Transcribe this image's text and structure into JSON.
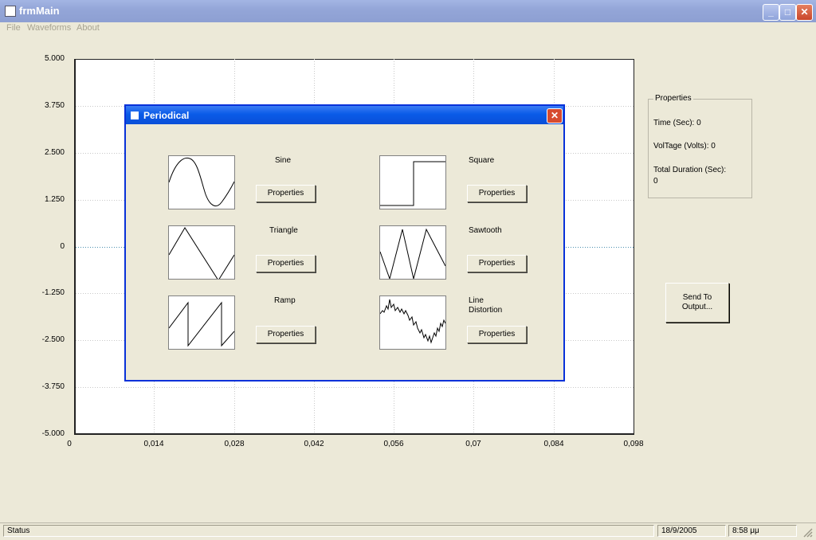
{
  "window": {
    "title": "frmMain"
  },
  "menu": [
    "File",
    "Waveforms",
    "About"
  ],
  "chart_data": {
    "type": "line",
    "y_ticks": [
      "5.000",
      "3.750",
      "2.500",
      "1.250",
      "0",
      "-1.250",
      "-2.500",
      "-3.750",
      "-5.000"
    ],
    "x_ticks": [
      "0",
      "0,014",
      "0,028",
      "0,042",
      "0,056",
      "0,07",
      "0,084",
      "0,098"
    ],
    "ylim": [
      -5,
      5
    ],
    "xlim": [
      0,
      0.098
    ],
    "grid": true,
    "series": []
  },
  "properties": {
    "title": "Properties",
    "time": "Time (Sec): 0",
    "voltage": "VolTage (Volts): 0",
    "duration_label": "Total Duration (Sec):",
    "duration_value": "0"
  },
  "send_button": {
    "line1": "Send To",
    "line2": "Output..."
  },
  "dialog": {
    "title": "Periodical",
    "waves": [
      {
        "label": "Sine",
        "button": "Properties",
        "icon": "sine-wave-icon"
      },
      {
        "label": "Square",
        "button": "Properties",
        "icon": "square-wave-icon"
      },
      {
        "label": "Triangle",
        "button": "Properties",
        "icon": "triangle-wave-icon"
      },
      {
        "label": "Sawtooth",
        "button": "Properties",
        "icon": "sawtooth-wave-icon"
      },
      {
        "label": "Ramp",
        "button": "Properties",
        "icon": "ramp-wave-icon"
      },
      {
        "label": "Line Distortion",
        "button": "Properties",
        "icon": "noise-wave-icon"
      }
    ]
  },
  "status": {
    "text": "Status",
    "date": "18/9/2005",
    "time": "8:58 μμ"
  }
}
